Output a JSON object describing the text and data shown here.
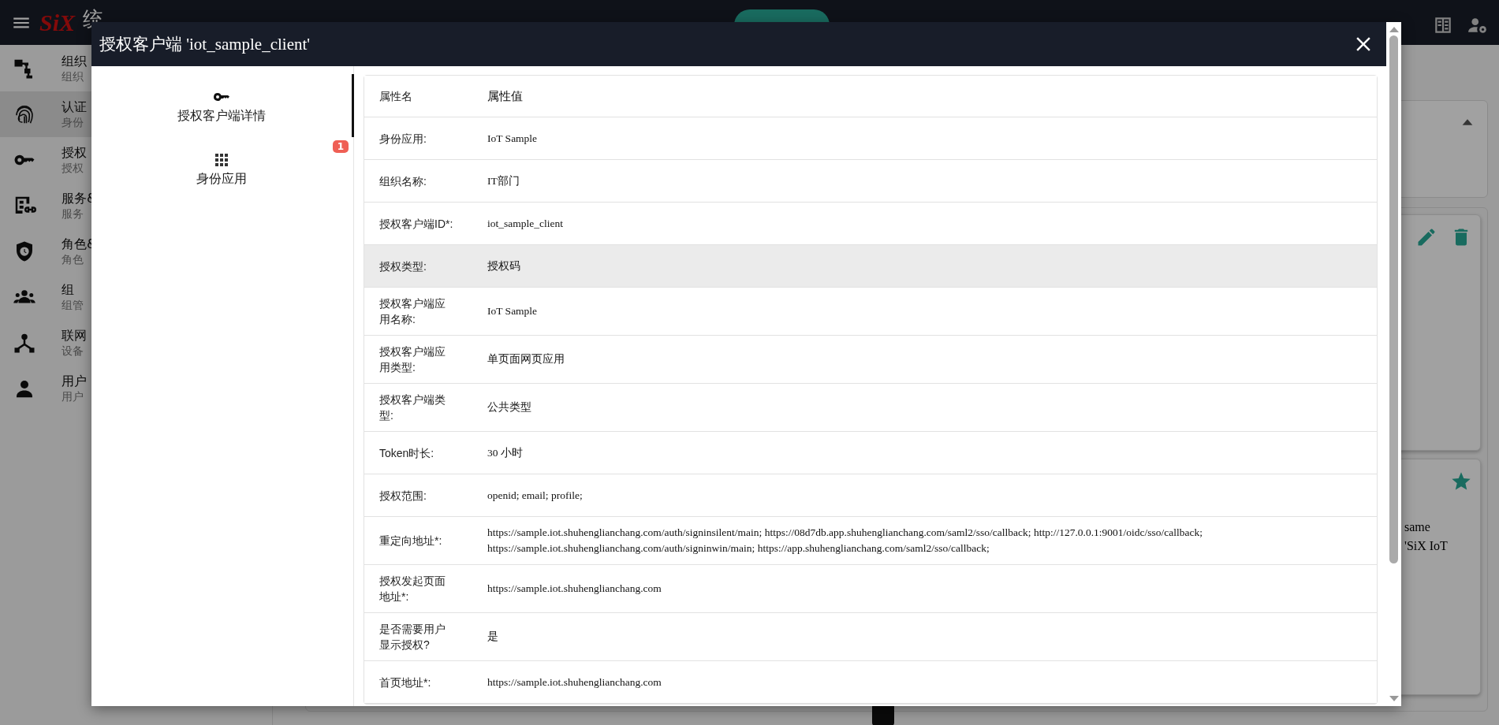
{
  "app_bar": {
    "logo": "SiX",
    "title": "统"
  },
  "sidebar": {
    "items": [
      {
        "title": "组织",
        "subtitle": "组织",
        "selected": false
      },
      {
        "title": "认证",
        "subtitle": "身份",
        "selected": true
      },
      {
        "title": "授权",
        "subtitle": "授权",
        "selected": false
      },
      {
        "title": "服务&",
        "subtitle": "服务",
        "selected": false
      },
      {
        "title": "角色&",
        "subtitle": "角色",
        "selected": false
      },
      {
        "title": "组",
        "subtitle": "组管",
        "selected": false
      },
      {
        "title": "联网",
        "subtitle": "设备",
        "selected": false
      },
      {
        "title": "用户",
        "subtitle": "用户",
        "selected": false
      }
    ]
  },
  "background_card": {
    "lines": [
      "same",
      "'SiX IoT"
    ]
  },
  "dialog": {
    "title": "授权客户端 'iot_sample_client'",
    "tabs": [
      {
        "label": "授权客户端详情",
        "selected": true,
        "kind": "key"
      },
      {
        "label": "身份应用",
        "selected": false,
        "kind": "grid",
        "badge": "1"
      }
    ],
    "table": {
      "columns": [
        "属性名",
        "属性值"
      ],
      "rows": [
        {
          "name": "身份应用:",
          "value": "IoT Sample",
          "highlighted": false
        },
        {
          "name": "组织名称:",
          "value": "IT部门",
          "highlighted": false
        },
        {
          "name": "授权客户端ID*:",
          "value": "iot_sample_client",
          "highlighted": false
        },
        {
          "name": "授权类型:",
          "value": "授权码",
          "highlighted": true
        },
        {
          "name": "授权客户端应用名称:",
          "value": "IoT Sample",
          "highlighted": false
        },
        {
          "name": "授权客户端应用类型:",
          "value": "单页面网页应用",
          "highlighted": false
        },
        {
          "name": "授权客户端类型:",
          "value": "公共类型",
          "highlighted": false
        },
        {
          "name": "Token时长:",
          "value": "30 小时",
          "highlighted": false
        },
        {
          "name": "授权范围:",
          "value": "openid; email; profile;",
          "highlighted": false
        },
        {
          "name": "重定向地址*:",
          "value": "https://sample.iot.shuhenglianchang.com/auth/signinsilent/main; https://08d7db.app.shuhenglianchang.com/saml2/sso/callback; http://127.0.0.1:9001/oidc/sso/callback; https://sample.iot.shuhenglianchang.com/auth/signinwin/main; https://app.shuhenglianchang.com/saml2/sso/callback;",
          "highlighted": false
        },
        {
          "name": "授权发起页面地址*:",
          "value": "https://sample.iot.shuhenglianchang.com",
          "highlighted": false
        },
        {
          "name": "是否需要用户显示授权?",
          "value": "是",
          "highlighted": false
        },
        {
          "name": "首页地址*:",
          "value": "https://sample.iot.shuhenglianchang.com",
          "highlighted": false
        }
      ]
    }
  }
}
